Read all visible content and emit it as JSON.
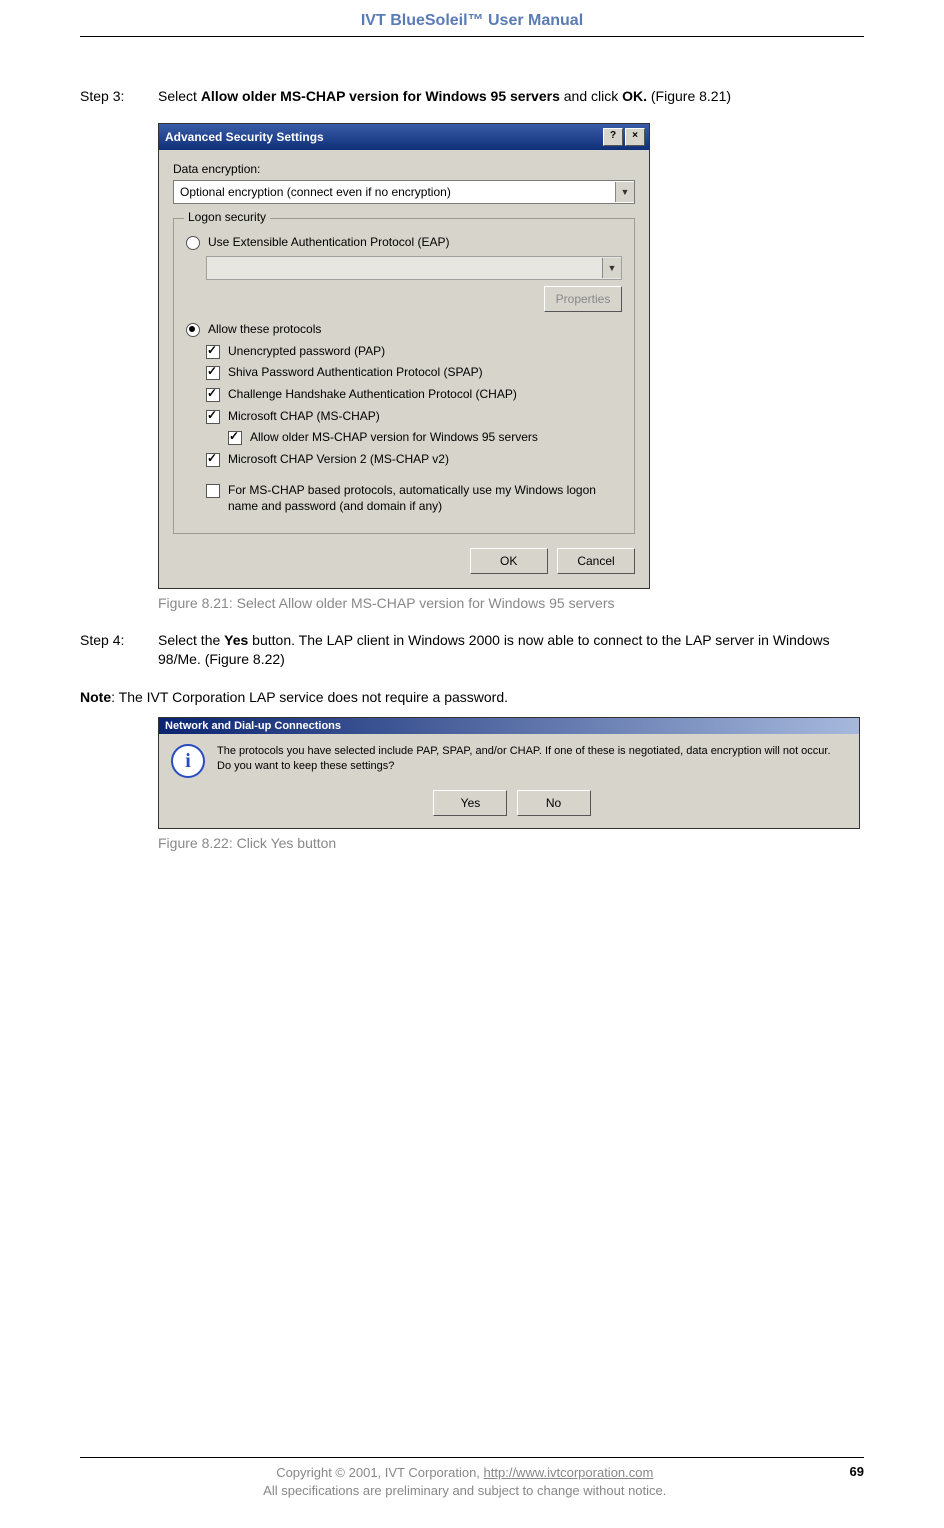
{
  "header": {
    "title": "IVT BlueSoleil™ User Manual"
  },
  "step3": {
    "label": "Step 3:",
    "pre": "Select ",
    "bold1": "Allow older MS-CHAP version for Windows 95 servers",
    "mid": " and click ",
    "bold2": "OK.",
    "post": " (Figure 8.21)"
  },
  "dialog1": {
    "title": "Advanced Security Settings",
    "help": "?",
    "close": "×",
    "encryption_label": "Data encryption:",
    "encryption_value": "Optional encryption (connect even if no encryption)",
    "group_label": "Logon security",
    "radio_eap": "Use Extensible Authentication Protocol (EAP)",
    "properties_btn": "Properties",
    "radio_protocols": "Allow these protocols",
    "chk_pap": "Unencrypted password (PAP)",
    "chk_spap": "Shiva Password Authentication Protocol (SPAP)",
    "chk_chap": "Challenge Handshake Authentication Protocol (CHAP)",
    "chk_mschap": "Microsoft CHAP (MS-CHAP)",
    "chk_mschap_older": "Allow older MS-CHAP version for Windows 95 servers",
    "chk_mschap2": "Microsoft CHAP Version 2 (MS-CHAP v2)",
    "chk_auto": "For MS-CHAP based protocols, automatically use my Windows logon name and password (and domain if any)",
    "ok": "OK",
    "cancel": "Cancel"
  },
  "caption1": "Figure 8.21: Select Allow older MS-CHAP version for Windows 95 servers",
  "step4": {
    "label": "Step 4:",
    "pre": "Select the ",
    "bold": "Yes",
    "post": " button. The LAP client in Windows 2000 is now able to connect to the LAP server in Windows 98/Me. (Figure 8.22)"
  },
  "note": {
    "label": "Note",
    "text": ": The IVT Corporation LAP service does not require a password."
  },
  "dialog2": {
    "title": "Network and Dial-up Connections",
    "text": "The protocols you have selected include PAP, SPAP, and/or CHAP.  If one of these is negotiated, data encryption will not occur.  Do you want to keep these settings?",
    "yes": "Yes",
    "no": "No"
  },
  "caption2": "Figure 8.22: Click Yes button",
  "footer": {
    "line1_pre": "Copyright © 2001, IVT Corporation, ",
    "line1_link": "http://www.ivtcorporation.com",
    "line2": "All specifications are preliminary and subject to change without notice.",
    "page": "69"
  }
}
